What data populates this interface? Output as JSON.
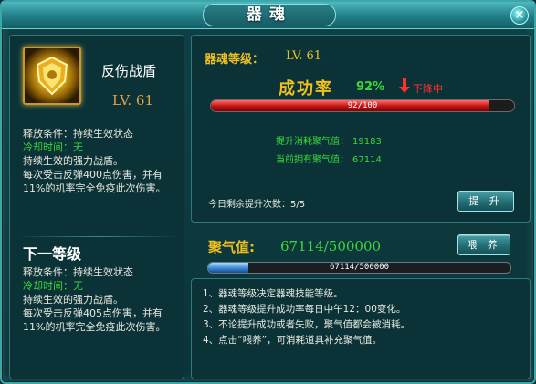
{
  "window": {
    "title": "器魂",
    "close_label": "×"
  },
  "skill": {
    "icon": "shield-emblem-icon",
    "name": "反伤战盾",
    "level": "LV. 61",
    "current": {
      "release_condition": "释放条件：持续生效状态",
      "cooldown": "冷却时间：无",
      "desc_lines": [
        "持续生效的强力战盾。",
        "每次受击反弹400点伤害，并有",
        "11%的机率完全免疫此次伤害。"
      ]
    },
    "next_title": "下一等级",
    "next": {
      "release_condition": "释放条件：持续生效状态",
      "cooldown": "冷却时间：无",
      "desc_lines": [
        "持续生效的强力战盾。",
        "每次受击反弹405点伤害，并有",
        "11%的机率完全免疫此次伤害。"
      ]
    }
  },
  "upgrade": {
    "label": "器魂等级：",
    "level": "LV. 61",
    "rate_label": "成功率",
    "rate_value": "92%",
    "trend_icon": "down-arrow-icon",
    "trend_text": "下降中",
    "bar_text": "92/100",
    "bar_fraction": 0.92,
    "cost_label": "提升消耗聚气值：",
    "cost_value": "19183",
    "owned_label": "当前拥有聚气值：",
    "owned_value": "67114",
    "remain_text": "今日剩余提升次数：5/5",
    "button_label": "提 升"
  },
  "energy": {
    "label": "聚气值:",
    "value": "67114/500000",
    "bar_text": "67114/500000",
    "bar_fraction": 0.134,
    "button_label": "喂 养"
  },
  "notes": [
    "1、器魂等级决定器魂技能等级。",
    "2、器魂等级提升成功率每日中午12：00变化。",
    "3、不论提升成功或者失败，聚气值都会被消耗。",
    "4、点击“喂养”，可消耗道具补充聚气值。"
  ],
  "colors": {
    "accent_gold": "#f0c020",
    "green": "#3ad83a",
    "red": "#ff3030",
    "frame": "#2f7a7e"
  }
}
